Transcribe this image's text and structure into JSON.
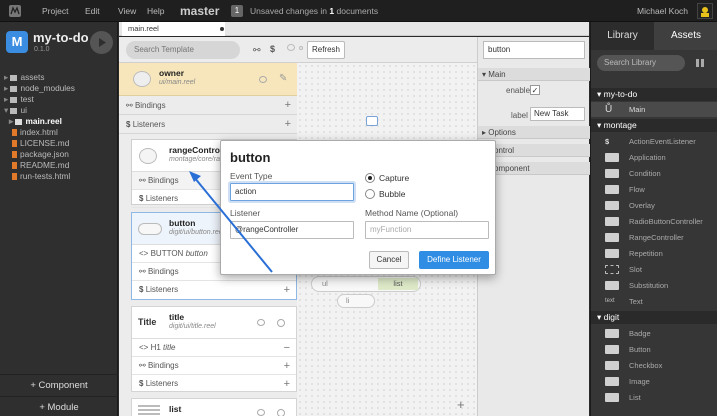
{
  "topbar": {
    "menu": [
      "Project",
      "Edit",
      "View",
      "Help"
    ],
    "branch": "master",
    "changes_count": "1",
    "changes_pre": "Unsaved changes in ",
    "changes_num": "1",
    "changes_post": " documents",
    "user": "Michael Koch"
  },
  "project": {
    "logo_letter": "M",
    "name": "my-to-do",
    "version": "0.1.0"
  },
  "files": [
    {
      "label": "assets",
      "kind": "folder"
    },
    {
      "label": "node_modules",
      "kind": "folder"
    },
    {
      "label": "test",
      "kind": "folder"
    },
    {
      "label": "ui",
      "kind": "folder-open"
    },
    {
      "label": "main.reel",
      "kind": "reel",
      "selected": true
    },
    {
      "label": "index.html",
      "kind": "file"
    },
    {
      "label": "LICENSE.md",
      "kind": "file"
    },
    {
      "label": "package.json",
      "kind": "file"
    },
    {
      "label": "README.md",
      "kind": "file"
    },
    {
      "label": "run-tests.html",
      "kind": "file"
    }
  ],
  "sidebar_buttons": {
    "component": "+ Component",
    "module": "+ Module"
  },
  "editor": {
    "tab": "main.reel",
    "search_placeholder": "Search Template",
    "refresh": "Refresh"
  },
  "cards": {
    "owner": {
      "title": "owner",
      "sub": "ui/main.reel",
      "bindings": "Bindings",
      "listeners": "Listeners"
    },
    "range": {
      "title": "rangeController",
      "sub": "montage/core/range-controller",
      "bindings": "Bindings",
      "listeners": "Listeners"
    },
    "button": {
      "title": "button",
      "sub": "digit/ui/button.reel",
      "element": "BUTTON",
      "element_name": "button",
      "bindings": "Bindings",
      "listeners": "Listeners"
    },
    "title": {
      "title": "title",
      "sub": "digit/ui/title.reel",
      "element": "H1",
      "element_name": "title",
      "bindings": "Bindings",
      "listeners": "Listeners",
      "badge": "Title"
    },
    "list": {
      "title": "list"
    }
  },
  "canvas": {
    "list_label": "list",
    "ul_label": "ul",
    "li_label": "li"
  },
  "properties": {
    "search_value": "button",
    "sections": [
      "Main",
      "Options",
      "Control",
      "Component"
    ],
    "enabled_label": "enabled",
    "label_label": "label",
    "label_value": "New Task"
  },
  "library": {
    "tabs": [
      "Library",
      "Assets"
    ],
    "search_placeholder": "Search Library",
    "sections": [
      {
        "name": "my-to-do",
        "items": [
          "Main"
        ]
      },
      {
        "name": "montage",
        "items": [
          "ActionEventListener",
          "Application",
          "Condition",
          "Flow",
          "Overlay",
          "RadioButtonController",
          "RangeController",
          "Repetition",
          "Slot",
          "Substitution",
          "Text"
        ]
      },
      {
        "name": "digit",
        "items": [
          "Badge",
          "Button",
          "Checkbox",
          "Image",
          "List"
        ]
      }
    ]
  },
  "dialog": {
    "title": "button",
    "event_type_label": "Event Type",
    "event_type_value": "action",
    "capture": "Capture",
    "bubble": "Bubble",
    "listener_label": "Listener",
    "listener_value": "@rangeController",
    "method_label": "Method Name (Optional)",
    "method_placeholder": "myFunction",
    "cancel": "Cancel",
    "define": "Define Listener"
  },
  "colors": {
    "accent": "#2f8de4",
    "arrow": "#2a6fd6",
    "selection": "#f7e6bb"
  }
}
